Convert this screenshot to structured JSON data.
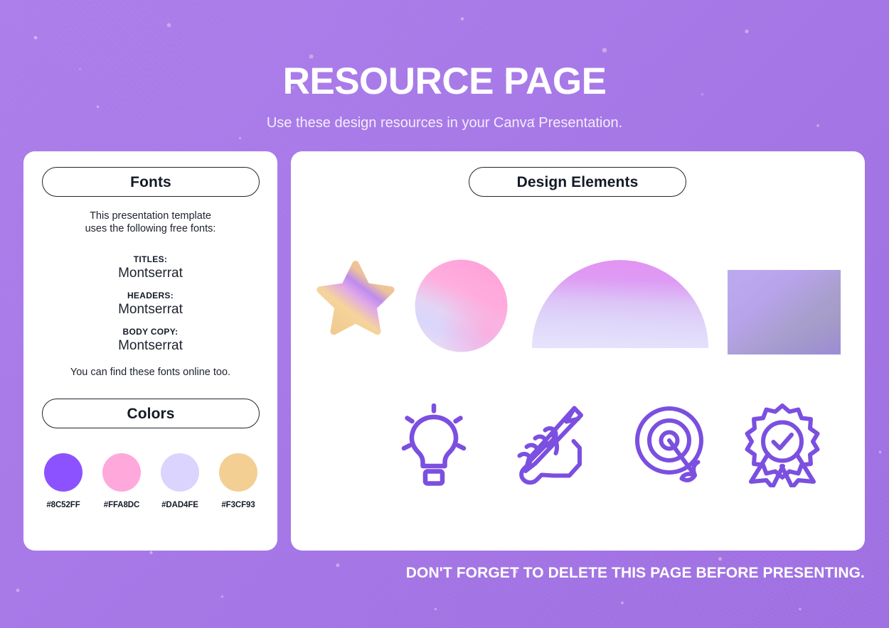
{
  "page": {
    "title": "RESOURCE PAGE",
    "subtitle": "Use these design resources in your Canva Presentation.",
    "footer_note": "DON'T FORGET TO DELETE THIS PAGE BEFORE PRESENTING.",
    "background_color": "#A87AE8",
    "card_color": "#FFFFFF",
    "text_color": "#131A26"
  },
  "fonts_panel": {
    "heading": "Fonts",
    "intro_line_1": "This presentation template",
    "intro_line_2": "uses the following free fonts:",
    "groups": [
      {
        "role": "TITLES:",
        "font": "Montserrat"
      },
      {
        "role": "HEADERS:",
        "font": "Montserrat"
      },
      {
        "role": "BODY COPY:",
        "font": "Montserrat"
      }
    ],
    "outro": "You can find these fonts online too."
  },
  "colors_panel": {
    "heading": "Colors",
    "swatches": [
      {
        "hex": "#8C52FF",
        "label": "#8C52FF",
        "name": "purple"
      },
      {
        "hex": "#FFA8DC",
        "label": "#FFA8DC",
        "name": "pink"
      },
      {
        "hex": "#DAD4FE",
        "label": "#DAD4FE",
        "name": "lavender"
      },
      {
        "hex": "#F3CF93",
        "label": "#F3CF93",
        "name": "sand"
      }
    ]
  },
  "elements_panel": {
    "heading": "Design Elements",
    "shapes": [
      {
        "name": "star",
        "gradient_from": "#F3CF93",
        "gradient_to": "#B98BEE"
      },
      {
        "name": "circle",
        "gradient_from": "#FFA8DC",
        "gradient_to": "#DAD4FE"
      },
      {
        "name": "semicircle",
        "gradient_from": "#E59CF5",
        "gradient_to": "#E4E0FB"
      },
      {
        "name": "square",
        "gradient_from": "#B9A4EA",
        "gradient_to": "#A49BC0"
      }
    ],
    "icons": [
      {
        "name": "lightbulb",
        "stroke": "#7B4FE0"
      },
      {
        "name": "hand-pencil",
        "stroke": "#7B4FE0"
      },
      {
        "name": "target-arrow",
        "stroke": "#7B4FE0"
      },
      {
        "name": "award-ribbon",
        "stroke": "#7B4FE0"
      }
    ]
  }
}
